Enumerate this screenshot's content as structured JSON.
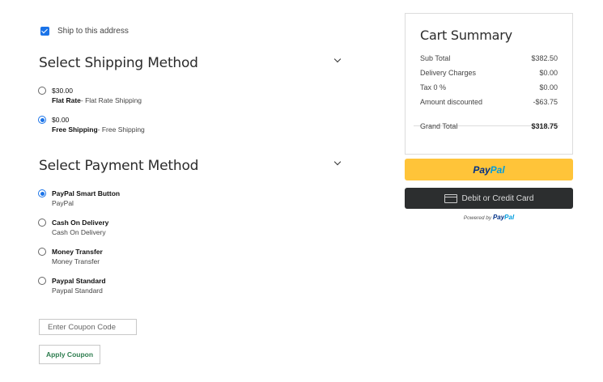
{
  "shipping_address": {
    "checkbox_label": "Ship to this address",
    "checked": true
  },
  "shipping": {
    "title": "Select Shipping Method",
    "options": [
      {
        "price": "$30.00",
        "name": "Flat Rate",
        "detail": "- Flat Rate Shipping",
        "selected": false
      },
      {
        "price": "$0.00",
        "name": "Free Shipping",
        "detail": "- Free Shipping",
        "selected": true
      }
    ]
  },
  "payment": {
    "title": "Select Payment Method",
    "options": [
      {
        "name": "PayPal Smart Button",
        "sub": "PayPal",
        "selected": true
      },
      {
        "name": "Cash On Delivery",
        "sub": "Cash On Delivery",
        "selected": false
      },
      {
        "name": "Money Transfer",
        "sub": "Money Transfer",
        "selected": false
      },
      {
        "name": "Paypal Standard",
        "sub": "Paypal Standard",
        "selected": false
      }
    ]
  },
  "coupon": {
    "placeholder": "Enter Coupon Code",
    "button": "Apply Coupon"
  },
  "cart": {
    "title": "Cart Summary",
    "rows": [
      {
        "label": "Sub Total",
        "value": "$382.50"
      },
      {
        "label": "Delivery Charges",
        "value": "$0.00"
      },
      {
        "label": "Tax 0 %",
        "value": "$0.00"
      },
      {
        "label": "Amount discounted",
        "value": "-$63.75"
      }
    ],
    "total": {
      "label": "Grand Total",
      "value": "$318.75"
    }
  },
  "paypal": {
    "button_pay": "Pay",
    "button_pal": "Pal",
    "card_button": "Debit or Credit Card",
    "powered_by": "Powered by",
    "brand_pay": "Pay",
    "brand_pal": "Pal"
  },
  "colors": {
    "accent": "#1a73e8",
    "paypal_yellow": "#ffc439",
    "card_dark": "#2c2e2f",
    "coupon_green": "#2e7d4f"
  },
  "icons": {
    "collapse": "chevron-down-icon",
    "card": "card-icon"
  }
}
